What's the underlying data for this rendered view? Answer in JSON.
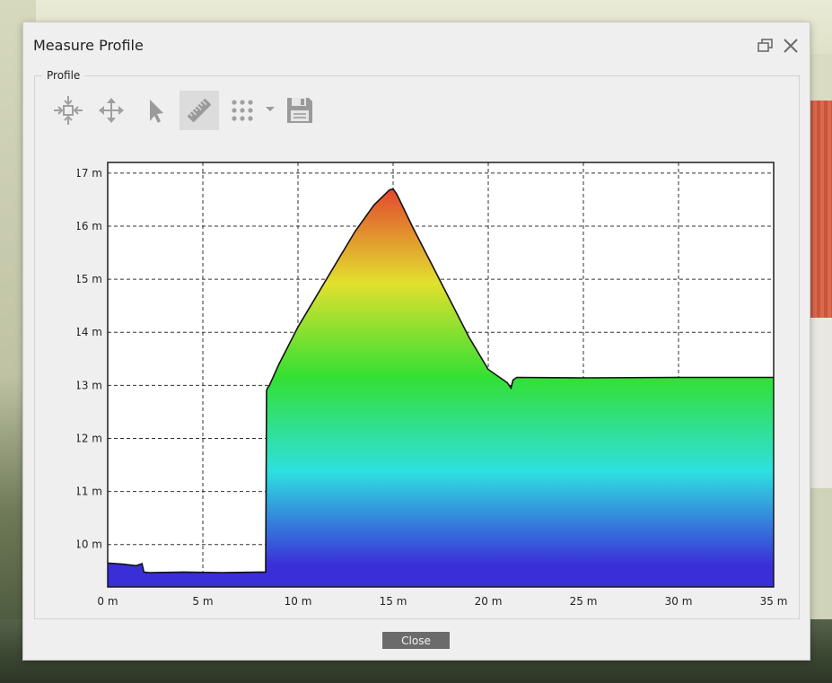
{
  "dialog": {
    "title": "Measure Profile",
    "group_label": "Profile",
    "close_button_label": "Close"
  },
  "toolbar": {
    "tools": [
      {
        "icon": "zoom-extents-icon",
        "active": false
      },
      {
        "icon": "pan-icon",
        "active": false
      },
      {
        "icon": "select-pointer-icon",
        "active": false
      },
      {
        "icon": "ruler-icon",
        "active": true
      },
      {
        "icon": "point-grid-icon",
        "active": false
      },
      {
        "icon": "save-icon",
        "active": false
      }
    ]
  },
  "colors": {
    "dialog_bg": "#efefef",
    "close_button_bg": "#6b6b6b",
    "gradient": [
      "#3a2ed8",
      "#2ee0e0",
      "#33e033",
      "#e2e02e",
      "#e2482e"
    ]
  },
  "chart_data": {
    "type": "area",
    "xlabel": "",
    "ylabel": "",
    "xlim": [
      0,
      35
    ],
    "ylim": [
      9.2,
      17.2
    ],
    "x_ticks": [
      0,
      5,
      10,
      15,
      20,
      25,
      30,
      35
    ],
    "x_tick_labels": [
      "0 m",
      "5 m",
      "10 m",
      "15 m",
      "20 m",
      "25 m",
      "30 m",
      "35 m"
    ],
    "y_ticks": [
      10,
      11,
      12,
      13,
      14,
      15,
      16,
      17
    ],
    "y_tick_labels": [
      "10 m",
      "11 m",
      "12 m",
      "13 m",
      "14 m",
      "15 m",
      "16 m",
      "17 m"
    ],
    "grid": true,
    "color_scale": {
      "min": 9.6,
      "max": 16.7
    },
    "series": [
      {
        "x": [
          0,
          0.8,
          1.5,
          1.8,
          1.9,
          2.2,
          4,
          6,
          8,
          8.3,
          8.35,
          8.4,
          8.5,
          9,
          10,
          11,
          12,
          13,
          14,
          14.8,
          15,
          15.2,
          16,
          17,
          18,
          19,
          20,
          21,
          21.2,
          21.3,
          21.5,
          25,
          30,
          35
        ],
        "values": [
          9.65,
          9.63,
          9.6,
          9.64,
          9.48,
          9.47,
          9.48,
          9.47,
          9.48,
          9.48,
          12.9,
          12.95,
          13.0,
          13.4,
          14.1,
          14.7,
          15.3,
          15.9,
          16.4,
          16.68,
          16.7,
          16.6,
          16.0,
          15.3,
          14.6,
          13.9,
          13.3,
          13.05,
          12.95,
          13.1,
          13.15,
          13.14,
          13.15,
          13.15
        ]
      }
    ]
  }
}
